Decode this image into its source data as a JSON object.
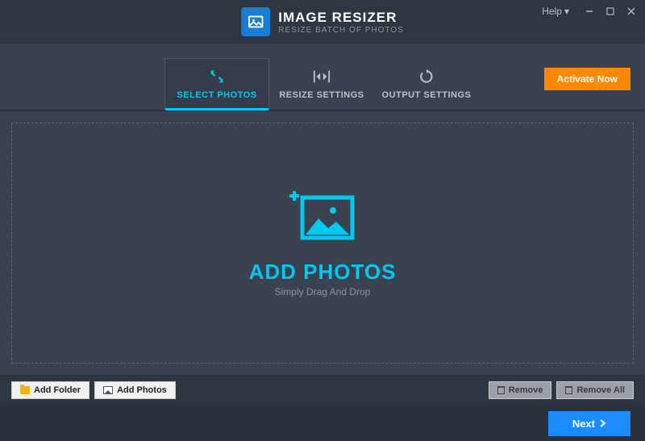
{
  "header": {
    "title": "IMAGE RESIZER",
    "subtitle": "RESIZE BATCH OF PHOTOS",
    "help": "Help"
  },
  "tabs": {
    "select": "SELECT PHOTOS",
    "resize": "RESIZE SETTINGS",
    "output": "OUTPUT SETTINGS"
  },
  "activate": "Activate Now",
  "dropzone": {
    "title": "ADD PHOTOS",
    "subtitle": "Simply Drag And Drop"
  },
  "toolbar": {
    "add_folder": "Add Folder",
    "add_photos": "Add Photos",
    "remove": "Remove",
    "remove_all": "Remove All"
  },
  "footer": {
    "next": "Next"
  }
}
